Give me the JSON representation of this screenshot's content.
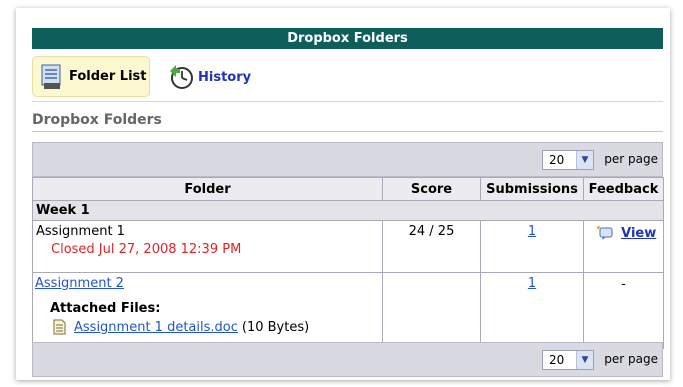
{
  "header": {
    "title": "Dropbox Folders"
  },
  "toolbar": {
    "folder_list_label": "Folder List",
    "history_label": "History"
  },
  "section": {
    "title": "Dropbox Folders"
  },
  "pager": {
    "per_page_value": "20",
    "per_page_label": "per page"
  },
  "table": {
    "columns": [
      "Folder",
      "Score",
      "Submissions",
      "Feedback"
    ],
    "group": "Week 1",
    "rows": [
      {
        "folder": "Assignment 1",
        "status": "Closed Jul 27, 2008 12:39 PM",
        "score": "24 / 25",
        "submissions": "1",
        "feedback": "View"
      },
      {
        "folder": "Assignment 2",
        "attached_label": "Attached Files:",
        "file_name": "Assignment 1 details.doc",
        "file_size": "(10 Bytes)",
        "score": "",
        "submissions": "1",
        "feedback": "-"
      }
    ]
  },
  "colors": {
    "header_bg": "#0e5e5c",
    "closed_text": "#e02424",
    "link": "#2255cc"
  },
  "icons": [
    "folder-list-icon",
    "history-clock-icon",
    "view-feedback-icon",
    "document-icon",
    "chevron-down-icon"
  ]
}
